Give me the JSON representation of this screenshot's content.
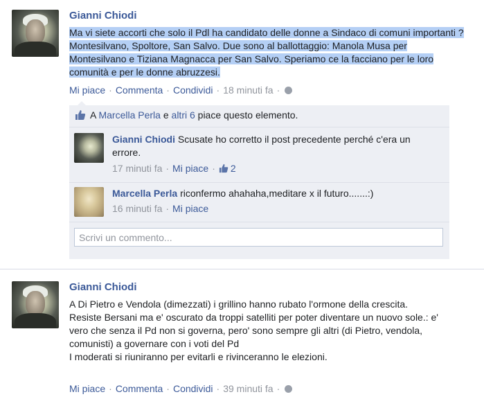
{
  "posts": [
    {
      "author": "Gianni Chiodi",
      "text": "Ma vi siete accorti che solo il Pdl ha candidato delle donne a Sindaco di comuni importanti ? Montesilvano, Spoltore, San Salvo. Due sono al ballottaggio: Manola Musa per Montesilvano e Tiziana Magnacca per San Salvo. Speriamo ce la facciano per le loro comunità e per le donne abruzzesi.",
      "like_label": "Mi piace",
      "comment_label": "Commenta",
      "share_label": "Condividi",
      "time": "18 minuti fa",
      "likes": {
        "prefix": "A",
        "name": "Marcella Perla",
        "connector": "e",
        "others": "altri 6",
        "suffix": "piace questo elemento."
      },
      "comments": [
        {
          "author": "Gianni Chiodi",
          "text": "Scusate ho corretto il post precedente perché c'era un errore.",
          "time": "17 minuti fa",
          "like_label": "Mi piace",
          "like_count": "2"
        },
        {
          "author": "Marcella Perla",
          "text": "riconfermo ahahaha,meditare x il futuro.......:)",
          "time": "16 minuti fa",
          "like_label": "Mi piace"
        }
      ],
      "comment_placeholder": "Scrivi un commento..."
    },
    {
      "author": "Gianni Chiodi",
      "text_lines": [
        "A Di Pietro e Vendola (dimezzati) i grillino hanno rubato l'ormone della crescita.",
        "Resiste Bersani ma e' oscurato da troppi satelliti per poter diventare un nuovo sole.: e' vero che senza il Pd non si governa, pero' sono sempre gli altri (di Pietro, vendola, comunisti) a governare con i voti del Pd",
        "I moderati si riuniranno per evitarli e rivinceranno le elezioni."
      ],
      "like_label": "Mi piace",
      "comment_label": "Commenta",
      "share_label": "Condividi",
      "time": "39 minuti fa"
    }
  ],
  "colors": {
    "link": "#3b5998",
    "meta": "#90949c",
    "highlight": "#b4cff5",
    "comment_bg": "#edeff4"
  }
}
